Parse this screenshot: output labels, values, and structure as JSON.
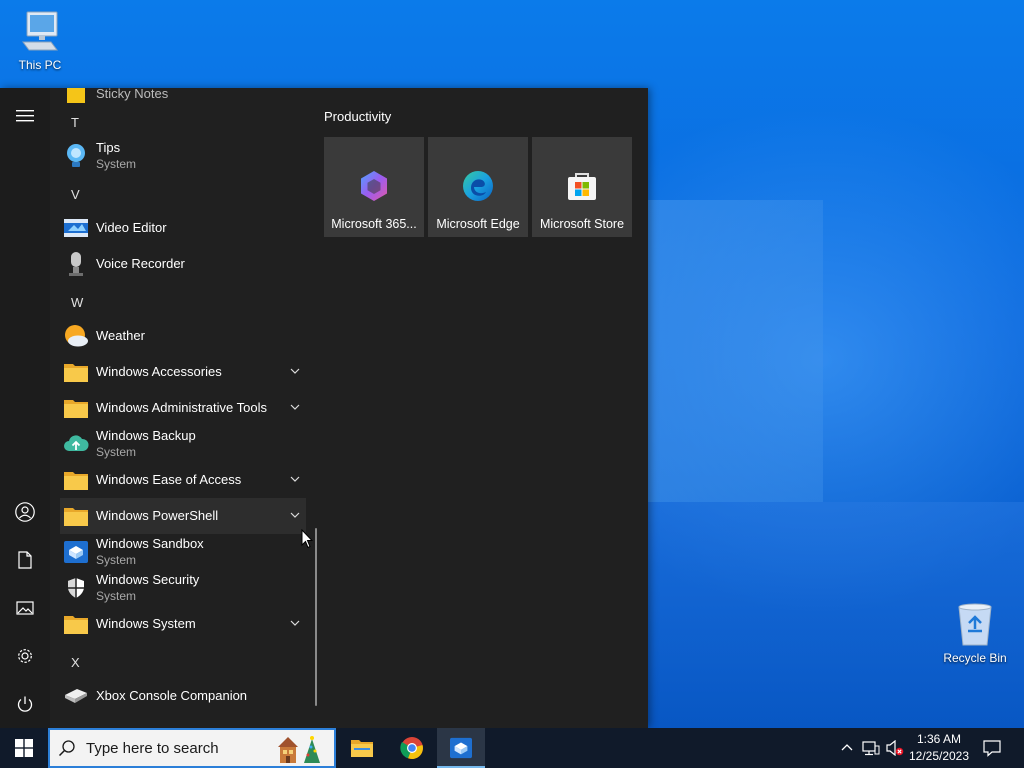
{
  "desktop": {
    "icons": [
      {
        "label": "This PC"
      },
      {
        "label": "Recycle Bin"
      }
    ]
  },
  "start_menu": {
    "rail": {
      "menu_icon": "hamburger-icon",
      "items": [
        "user-icon",
        "documents-icon",
        "pictures-icon",
        "settings-gear-icon",
        "power-icon"
      ]
    },
    "partial_top_item": "Sticky Notes",
    "letters": [
      "T",
      "V",
      "W",
      "X"
    ],
    "apps": [
      {
        "name": "Tips",
        "sub": "System",
        "expandable": false
      },
      {
        "name": "Video Editor",
        "sub": "",
        "expandable": false
      },
      {
        "name": "Voice Recorder",
        "sub": "",
        "expandable": false
      },
      {
        "name": "Weather",
        "sub": "",
        "expandable": false
      },
      {
        "name": "Windows Accessories",
        "sub": "",
        "expandable": true
      },
      {
        "name": "Windows Administrative Tools",
        "sub": "",
        "expandable": true
      },
      {
        "name": "Windows Backup",
        "sub": "System",
        "expandable": false
      },
      {
        "name": "Windows Ease of Access",
        "sub": "",
        "expandable": true
      },
      {
        "name": "Windows PowerShell",
        "sub": "",
        "expandable": true
      },
      {
        "name": "Windows Sandbox",
        "sub": "System",
        "expandable": false
      },
      {
        "name": "Windows Security",
        "sub": "System",
        "expandable": false
      },
      {
        "name": "Windows System",
        "sub": "",
        "expandable": true
      },
      {
        "name": "Xbox Console Companion",
        "sub": "",
        "expandable": false
      }
    ],
    "tiles": {
      "group_title": "Productivity",
      "items": [
        {
          "label": "Microsoft 365...",
          "icon": "microsoft-365-icon"
        },
        {
          "label": "Microsoft Edge",
          "icon": "edge-icon"
        },
        {
          "label": "Microsoft Store",
          "icon": "store-icon"
        }
      ]
    }
  },
  "taskbar": {
    "search_placeholder": "Type here to search",
    "pinned": [
      "file-explorer-icon",
      "chrome-icon",
      "windows-sandbox-icon"
    ],
    "tray": {
      "time": "1:36 AM",
      "date": "12/25/2023",
      "icons": [
        "chevron-up-icon",
        "network-icon",
        "volume-muted-icon",
        "notification-icon"
      ]
    }
  },
  "colors": {
    "start_bg": "#202020",
    "tile_bg": "#3a3a3a",
    "taskbar_bg": "#101a2a",
    "accent": "#0078d4"
  }
}
